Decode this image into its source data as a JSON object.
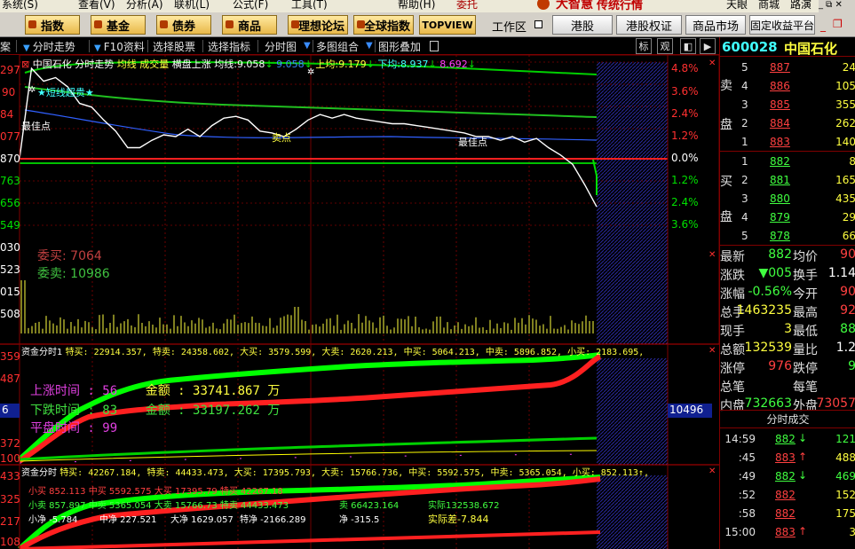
{
  "menubar": {
    "items": [
      "系统(S)",
      "查看(V)",
      "分析(A)",
      "联机(L)",
      "公式(F)",
      "工具(T)",
      "帮助(H)"
    ],
    "right_items": [
      "委托",
      "天眼",
      "商城",
      "路演"
    ],
    "brand": "大智慧",
    "brand_sub": "传统行情"
  },
  "toolbar": {
    "buttons": [
      "指数",
      "基金",
      "债券",
      "商品",
      "理想论坛",
      "全球指数",
      "TOPVIEW"
    ],
    "workspace": "工作区",
    "plain_buttons": [
      "港股",
      "港股权证",
      "商品市场",
      "固定收益平台"
    ]
  },
  "tabs": [
    "分时走势",
    "F10资料",
    "选择股票",
    "选择指标",
    "分时图",
    "多图组合",
    "图形叠加"
  ],
  "tab_prefix": "案",
  "tab_small_buttons": [
    "标",
    "观"
  ],
  "stock": {
    "code": "600028",
    "name": "中国石化"
  },
  "chart_header": {
    "name": "中国石化",
    "mode": "分时走势",
    "f1": "均线",
    "f2": "成交量",
    "f3": "横盘上涨",
    "ma_label": "均线:",
    "ma_value": "9.058",
    "ma2": "9.058",
    "up_label": "上均:",
    "up_value": "9.179",
    "down_label": "下均:",
    "down_value": "8.937",
    "last": "8.692"
  },
  "annotations": {
    "star_text": "★短线超贵★",
    "best1": "最佳点",
    "best2": "最佳点",
    "sell": "卖点"
  },
  "price_axis_left": [
    "297",
    "90",
    "84",
    "077",
    "870",
    "763",
    "656",
    "549"
  ],
  "pct_axis": [
    {
      "text": "4.8%",
      "color": "red"
    },
    {
      "text": "3.6%",
      "color": "red"
    },
    {
      "text": "2.4%",
      "color": "red"
    },
    {
      "text": "1.2%",
      "color": "red"
    },
    {
      "text": "0.0%",
      "color": "white"
    },
    {
      "text": "1.2%",
      "color": "green"
    },
    {
      "text": "2.4%",
      "color": "green"
    },
    {
      "text": "3.6%",
      "color": "green"
    }
  ],
  "vol_axis_left": [
    "030",
    "523",
    "015",
    "508"
  ],
  "orders": {
    "buy_label": "委买:",
    "buy_value": "7064",
    "sell_label": "委卖:",
    "sell_value": "10986"
  },
  "fund_panel1": {
    "title": "资金分时1",
    "items": "特买: 22914.357, 特卖: 24358.602, 大买: 3579.599, 大卖: 2620.213, 中买: 5064.213, 中卖: 5896.852, 小买: 2183.695,",
    "up_time_label": "上涨时间 :",
    "up_time": "56",
    "up_amt_label": "金额 :",
    "up_amt": "33741.867 万",
    "down_time_label": "下跌时间 :",
    "down_time": "83",
    "down_amt_label": "金额 :",
    "down_amt": "33197.262 万",
    "flat_time_label": "平盘时间 :",
    "flat_time": "99",
    "badge_left": "6",
    "badge_right": "10496",
    "axis_left": [
      "359",
      "487",
      "614",
      "372",
      "100"
    ]
  },
  "fund_panel2": {
    "title": "资金分时",
    "items": "特买: 42267.184, 特卖: 44433.473, 大买: 17395.793, 大卖: 15766.736, 中买: 5592.575, 中卖: 5365.054, 小买: 852.113↑,",
    "line1": "小买 852.113  中买 5592.575 大买 17395.79 特买 42267.18",
    "line2": "小卖 857.897  中卖 5365.054 大卖 15766.73 特卖 44433.473",
    "line2b": "卖 66423.164",
    "line2c": "实际132538.672",
    "line3a": "小净 -5.784",
    "line3b": "中净 227.521",
    "line3c": "大净 1629.057",
    "line3d": "特净 -2166.289",
    "line3e": "净 -315.5",
    "line3f": "实际差-7.844",
    "axis_left": [
      "433",
      "325",
      "217",
      "108"
    ]
  },
  "orderbook": {
    "sell": [
      {
        "lvl": "5",
        "p": "887",
        "v": "24"
      },
      {
        "lvl": "4",
        "p": "886",
        "v": "105"
      },
      {
        "lvl": "3",
        "p": "885",
        "v": "355"
      },
      {
        "lvl": "2",
        "p": "884",
        "v": "262"
      },
      {
        "lvl": "1",
        "p": "883",
        "v": "140"
      }
    ],
    "buy": [
      {
        "lvl": "1",
        "p": "882",
        "v": "8"
      },
      {
        "lvl": "2",
        "p": "881",
        "v": "165"
      },
      {
        "lvl": "3",
        "p": "880",
        "v": "435"
      },
      {
        "lvl": "4",
        "p": "879",
        "v": "29"
      },
      {
        "lvl": "5",
        "p": "878",
        "v": "66"
      }
    ],
    "sell_label": [
      "卖",
      "盘"
    ],
    "buy_label": [
      "买",
      "盘"
    ]
  },
  "quote": [
    {
      "l1": "最新",
      "v1": "882",
      "l2": "均价",
      "v2": "90"
    },
    {
      "l1": "涨跌",
      "v1": "▼005",
      "l2": "换手",
      "v2": "1.14"
    },
    {
      "l1": "涨幅",
      "v1": "-0.56%",
      "l2": "今开",
      "v2": "90"
    },
    {
      "l1": "总手",
      "v1": "1463235",
      "l2": "最高",
      "v2": "92"
    },
    {
      "l1": "现手",
      "v1": "3",
      "l2": "最低",
      "v2": "88"
    },
    {
      "l1": "总额",
      "v1": "132539",
      "l2": "量比",
      "v2": "1.2"
    },
    {
      "l1": "涨停",
      "v1": "976",
      "l2": "跌停",
      "v2": "9"
    },
    {
      "l1": "总笔",
      "v1": "",
      "l2": "每笔",
      "v2": ""
    },
    {
      "l1": "内盘",
      "v1": "732663",
      "l2": "外盘",
      "v2": "73057"
    }
  ],
  "ticks": {
    "title": "分时成交",
    "rows": [
      {
        "t": "14:59",
        "p": "882",
        "dir": "down",
        "v": "121"
      },
      {
        "t": ":45",
        "p": "883",
        "dir": "up",
        "v": "488"
      },
      {
        "t": ":49",
        "p": "882",
        "dir": "down",
        "v": "469"
      },
      {
        "t": ":52",
        "p": "882",
        "dir": "",
        "v": "152"
      },
      {
        "t": ":58",
        "p": "882",
        "dir": "",
        "v": "175"
      },
      {
        "t": "15:00",
        "p": "883",
        "dir": "up",
        "v": "3"
      }
    ]
  },
  "colors": {
    "up": "#ff3030",
    "down": "#00e000",
    "flat": "#ffffff",
    "panel_border": "#800000",
    "grid": "#800000",
    "hatch": "#1a1a6a",
    "price_line": "#ffffff",
    "avg_line": "#3060ff",
    "up_band": "#ffff00",
    "mid_band": "#00c000"
  },
  "chart_data": {
    "type": "line",
    "price_series": [
      0.0,
      4.9,
      4.2,
      4.4,
      3.9,
      3.0,
      2.8,
      2.1,
      1.5,
      0.6,
      0.6,
      1.0,
      1.3,
      1.2,
      1.6,
      1.2,
      1.8,
      2.2,
      2.3,
      2.1,
      1.5,
      1.4,
      1.2,
      1.6,
      2.1,
      2.4,
      2.2,
      2.4,
      2.2,
      2.1,
      2.0,
      1.9,
      1.9,
      1.8,
      1.7,
      1.6,
      1.5,
      1.4,
      1.2,
      1.2,
      1.0,
      1.2,
      0.9,
      1.1,
      0.6,
      0.2,
      -0.3,
      -1.4,
      -2.6
    ]
  }
}
